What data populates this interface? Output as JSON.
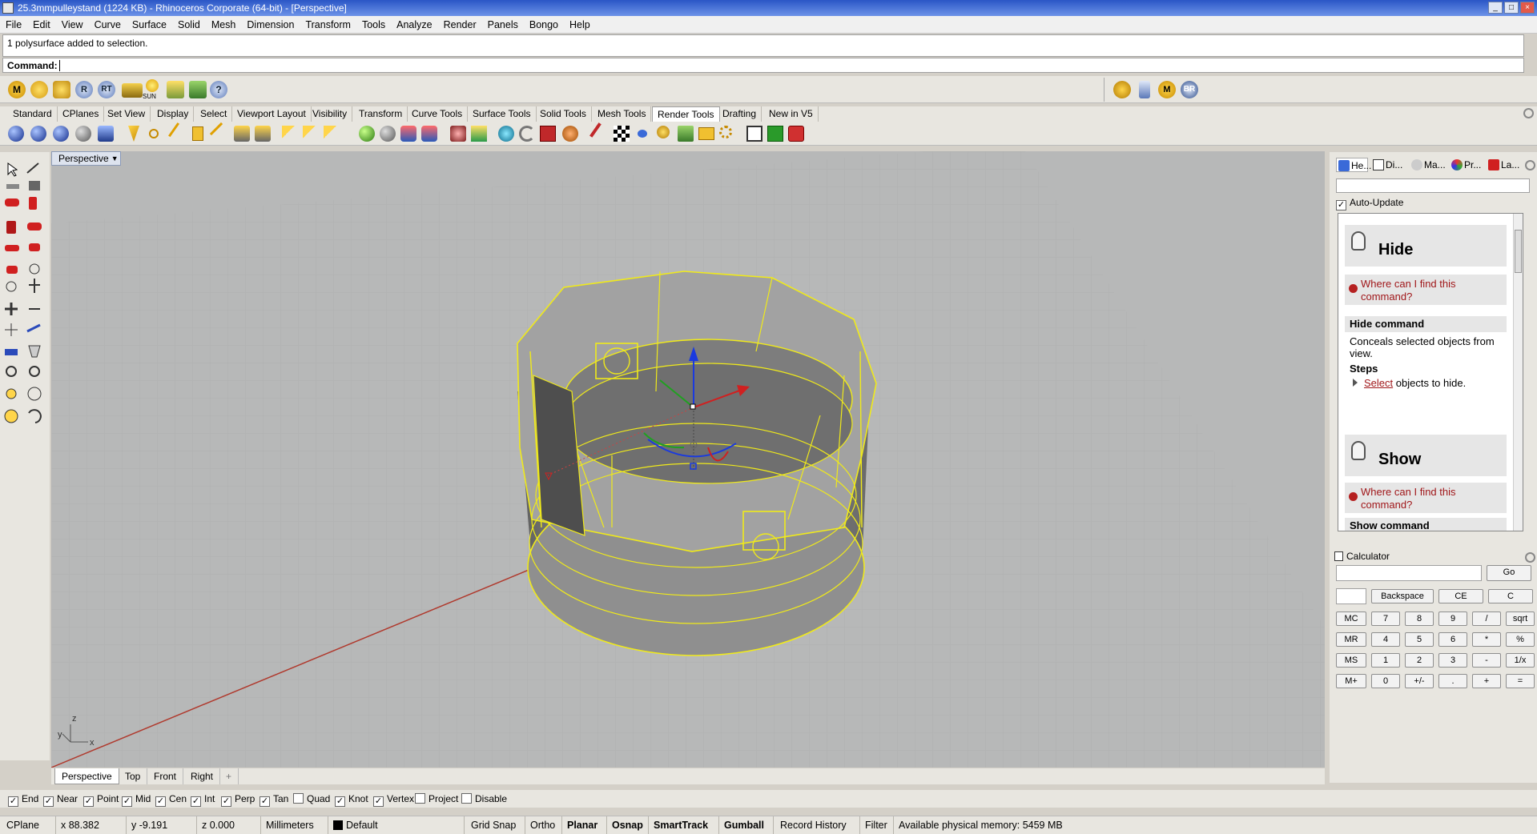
{
  "window": {
    "title": "25.3mmpulleystand (1224 KB) - Rhinoceros Corporate (64-bit) - [Perspective]"
  },
  "menu": [
    "File",
    "Edit",
    "View",
    "Curve",
    "Surface",
    "Solid",
    "Mesh",
    "Dimension",
    "Transform",
    "Tools",
    "Analyze",
    "Render",
    "Panels",
    "Bongo",
    "Help"
  ],
  "command": {
    "history": "1 polysurface added to selection.",
    "prompt": "Command:"
  },
  "toolbar_tabs": [
    "Standard",
    "CPlanes",
    "Set View",
    "Display",
    "Select",
    "Viewport Layout",
    "Visibility",
    "Transform",
    "Curve Tools",
    "Surface Tools",
    "Solid Tools",
    "Mesh Tools",
    "Render Tools",
    "Drafting",
    "New in V5"
  ],
  "active_toolbar_tab": "Render Tools",
  "top_icons": [
    "M",
    "RT",
    "R",
    "SUN",
    "BR"
  ],
  "viewport": {
    "label": "Perspective",
    "axes": {
      "x": "x",
      "y": "y",
      "z": "z"
    }
  },
  "viewport_tabs": [
    "Perspective",
    "Top",
    "Front",
    "Right",
    "+"
  ],
  "osnaps": [
    {
      "label": "End",
      "checked": true
    },
    {
      "label": "Near",
      "checked": true
    },
    {
      "label": "Point",
      "checked": true
    },
    {
      "label": "Mid",
      "checked": true
    },
    {
      "label": "Cen",
      "checked": true
    },
    {
      "label": "Int",
      "checked": true
    },
    {
      "label": "Perp",
      "checked": true
    },
    {
      "label": "Tan",
      "checked": true
    },
    {
      "label": "Quad",
      "checked": false
    },
    {
      "label": "Knot",
      "checked": true
    },
    {
      "label": "Vertex",
      "checked": true
    },
    {
      "label": "Project",
      "checked": false
    },
    {
      "label": "Disable",
      "checked": false
    }
  ],
  "status": {
    "cplane": "CPlane",
    "x": "x 88.382",
    "y": "y -9.191",
    "z": "z 0.000",
    "units": "Millimeters",
    "layer": "Default",
    "grid_snap": "Grid Snap",
    "ortho": "Ortho",
    "planar": "Planar",
    "osnap": "Osnap",
    "smarttrack": "SmartTrack",
    "gumball": "Gumball",
    "record_history": "Record History",
    "filter": "Filter",
    "memory": "Available physical memory: 5459 MB"
  },
  "panel_tabs": [
    "He...",
    "Di...",
    "Ma...",
    "Pr...",
    "La..."
  ],
  "help": {
    "auto_update": "Auto-Update",
    "hide_title": "Hide",
    "where": "Where can I find this command?",
    "hide_command": "Hide command",
    "hide_desc": "Conceals selected objects from view.",
    "steps": "Steps",
    "step_link": "Select",
    "step_rest": "objects to hide.",
    "show_title": "Show",
    "show_command": "Show command"
  },
  "calculator": {
    "title": "Calculator",
    "go": "Go",
    "backspace": "Backspace",
    "ce": "CE",
    "c": "C",
    "rows": [
      [
        "MC",
        "7",
        "8",
        "9",
        "/",
        "sqrt"
      ],
      [
        "MR",
        "4",
        "5",
        "6",
        "*",
        "%"
      ],
      [
        "MS",
        "1",
        "2",
        "3",
        "-",
        "1/x"
      ],
      [
        "M+",
        "0",
        "+/-",
        ".",
        "+",
        "="
      ]
    ]
  },
  "colors": {
    "selection": "#f0ea1a",
    "viewport_bg": "#b7b8b8",
    "x_axis": "#c0392b",
    "title_blue": "#2a56c6"
  }
}
